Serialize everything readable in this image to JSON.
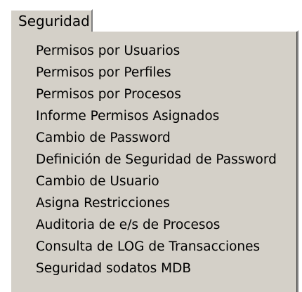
{
  "menu": {
    "title": "Seguridad",
    "items": [
      {
        "label": "Permisos por Usuarios"
      },
      {
        "label": "Permisos por Perfiles"
      },
      {
        "label": "Permisos por Procesos"
      },
      {
        "label": "Informe Permisos Asignados"
      },
      {
        "label": "Cambio de Password"
      },
      {
        "label": "Definición de Seguridad de Password"
      },
      {
        "label": "Cambio de Usuario"
      },
      {
        "label": "Asigna Restricciones"
      },
      {
        "label": "Auditoria de e/s de Procesos"
      },
      {
        "label": "Consulta de LOG de Transacciones"
      },
      {
        "label": "Seguridad sodatos MDB"
      }
    ]
  },
  "colors": {
    "menu_background": "#d4d0c8",
    "highlight": "#ffffff",
    "shadow": "#808080",
    "text": "#000000"
  }
}
